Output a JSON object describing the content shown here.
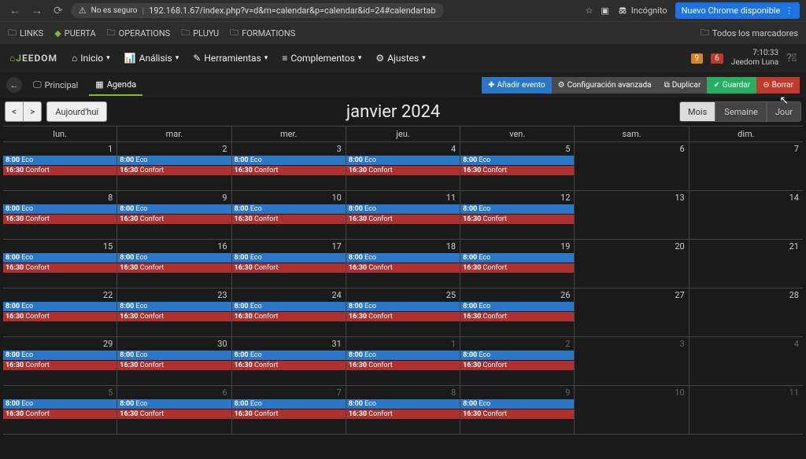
{
  "browser": {
    "not_secure": "No es seguro",
    "url": "192.168.1.67/index.php?v=d&m=calendar&p=calendar&id=24#calendartab",
    "star": "☆",
    "incognito_label": "Incógnito",
    "chrome_update": "Nuevo Chrome disponible"
  },
  "bookmarks": {
    "items": [
      "LINKS",
      "PUERTA",
      "OPERATIONS",
      "PLUYU",
      "FORMATIONS"
    ],
    "all": "Todos los marcadores"
  },
  "menu": {
    "logo_j": "J",
    "logo_rest": "EEDOM",
    "home": "Inicio",
    "analysis": "Análisis",
    "tools": "Herramientas",
    "plugins": "Complementos",
    "settings": "Ajustes",
    "badge_orange": "9",
    "badge_red": "6",
    "clock_time": "7:10:33",
    "clock_name": "Jeedom Luna"
  },
  "subbar": {
    "principal": "Principal",
    "agenda": "Agenda",
    "add": "Añadir evento",
    "config": "Configuración avanzada",
    "dup": "Duplicar",
    "save": "Guardar",
    "del": "Borrar"
  },
  "calendar": {
    "today": "Aujourd'hui",
    "title": "janvier 2024",
    "views": {
      "month": "Mois",
      "week": "Semaine",
      "day": "Jour"
    },
    "weekdays": [
      "lun.",
      "mar.",
      "mer.",
      "jeu.",
      "ven.",
      "sam.",
      "dim."
    ],
    "event_eco_time": "8:00",
    "event_eco_label": "Eco",
    "event_conf_time": "16:30",
    "event_conf_label": "Confort",
    "weeks": [
      {
        "days": [
          {
            "n": "1",
            "ev": true
          },
          {
            "n": "2",
            "ev": true
          },
          {
            "n": "3",
            "ev": true
          },
          {
            "n": "4",
            "ev": true
          },
          {
            "n": "5",
            "ev": true
          },
          {
            "n": "6",
            "ev": false
          },
          {
            "n": "7",
            "ev": false
          }
        ]
      },
      {
        "days": [
          {
            "n": "8",
            "ev": true
          },
          {
            "n": "9",
            "ev": true
          },
          {
            "n": "10",
            "ev": true
          },
          {
            "n": "11",
            "ev": true
          },
          {
            "n": "12",
            "ev": true
          },
          {
            "n": "13",
            "ev": false
          },
          {
            "n": "14",
            "ev": false
          }
        ]
      },
      {
        "days": [
          {
            "n": "15",
            "ev": true
          },
          {
            "n": "16",
            "ev": true
          },
          {
            "n": "17",
            "ev": true
          },
          {
            "n": "18",
            "ev": true
          },
          {
            "n": "19",
            "ev": true
          },
          {
            "n": "20",
            "ev": false
          },
          {
            "n": "21",
            "ev": false
          }
        ]
      },
      {
        "days": [
          {
            "n": "22",
            "ev": true
          },
          {
            "n": "23",
            "ev": true
          },
          {
            "n": "24",
            "ev": true
          },
          {
            "n": "25",
            "ev": true
          },
          {
            "n": "26",
            "ev": true
          },
          {
            "n": "27",
            "ev": false
          },
          {
            "n": "28",
            "ev": false
          }
        ]
      },
      {
        "days": [
          {
            "n": "29",
            "ev": true
          },
          {
            "n": "30",
            "ev": true
          },
          {
            "n": "31",
            "ev": true
          },
          {
            "n": "1",
            "ev": true,
            "faded": true
          },
          {
            "n": "2",
            "ev": true,
            "faded": true
          },
          {
            "n": "3",
            "ev": false,
            "faded": true
          },
          {
            "n": "4",
            "ev": false,
            "faded": true
          }
        ]
      },
      {
        "days": [
          {
            "n": "5",
            "ev": true,
            "faded": true
          },
          {
            "n": "6",
            "ev": true,
            "faded": true
          },
          {
            "n": "7",
            "ev": true,
            "faded": true
          },
          {
            "n": "8",
            "ev": true,
            "faded": true
          },
          {
            "n": "9",
            "ev": true,
            "faded": true
          },
          {
            "n": "10",
            "ev": false,
            "faded": true
          },
          {
            "n": "11",
            "ev": false,
            "faded": true
          }
        ]
      }
    ]
  }
}
